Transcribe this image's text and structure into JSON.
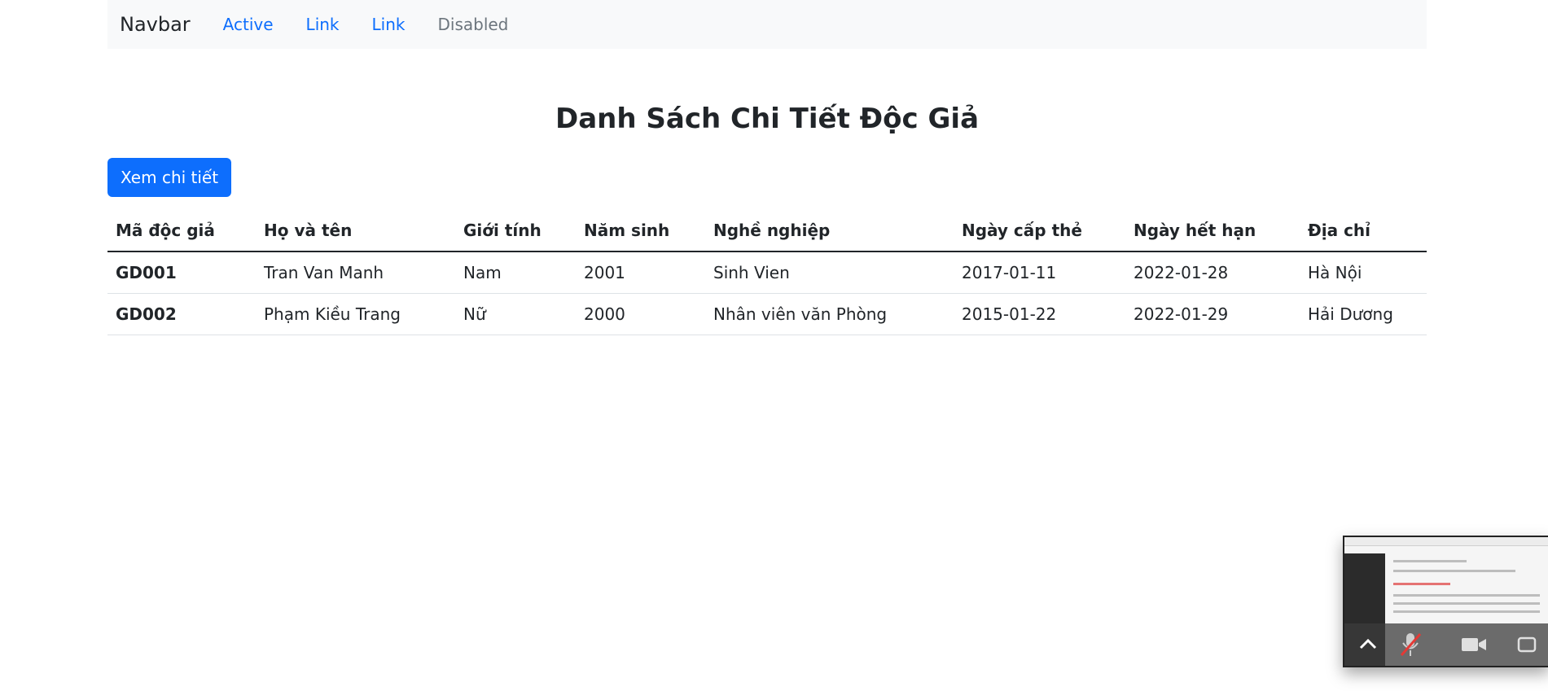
{
  "navbar": {
    "brand": "Navbar",
    "links": [
      "Active",
      "Link",
      "Link",
      "Disabled"
    ]
  },
  "page": {
    "title": "Danh Sách Chi Tiết Độc Giả",
    "detail_button": "Xem chi tiết"
  },
  "table": {
    "headers": [
      "Mã độc giả",
      "Họ và tên",
      "Giới tính",
      "Năm sinh",
      "Nghề nghiệp",
      "Ngày cấp thẻ",
      "Ngày hết hạn",
      "Địa chỉ"
    ],
    "rows": [
      [
        "GD001",
        "Tran Van Manh",
        "Nam",
        "2001",
        "Sinh Vien",
        "2017-01-11",
        "2022-01-28",
        "Hà Nội"
      ],
      [
        "GD002",
        "Phạm Kiều Trang",
        "Nữ",
        "2000",
        "Nhân viên văn Phòng",
        "2015-01-22",
        "2022-01-29",
        "Hải Dương"
      ]
    ]
  },
  "pip_overlay": {
    "controls": [
      "chevron-up-icon",
      "microphone-muted-icon",
      "video-camera-icon",
      "share-screen-icon"
    ],
    "accent_color": "#e53935"
  }
}
